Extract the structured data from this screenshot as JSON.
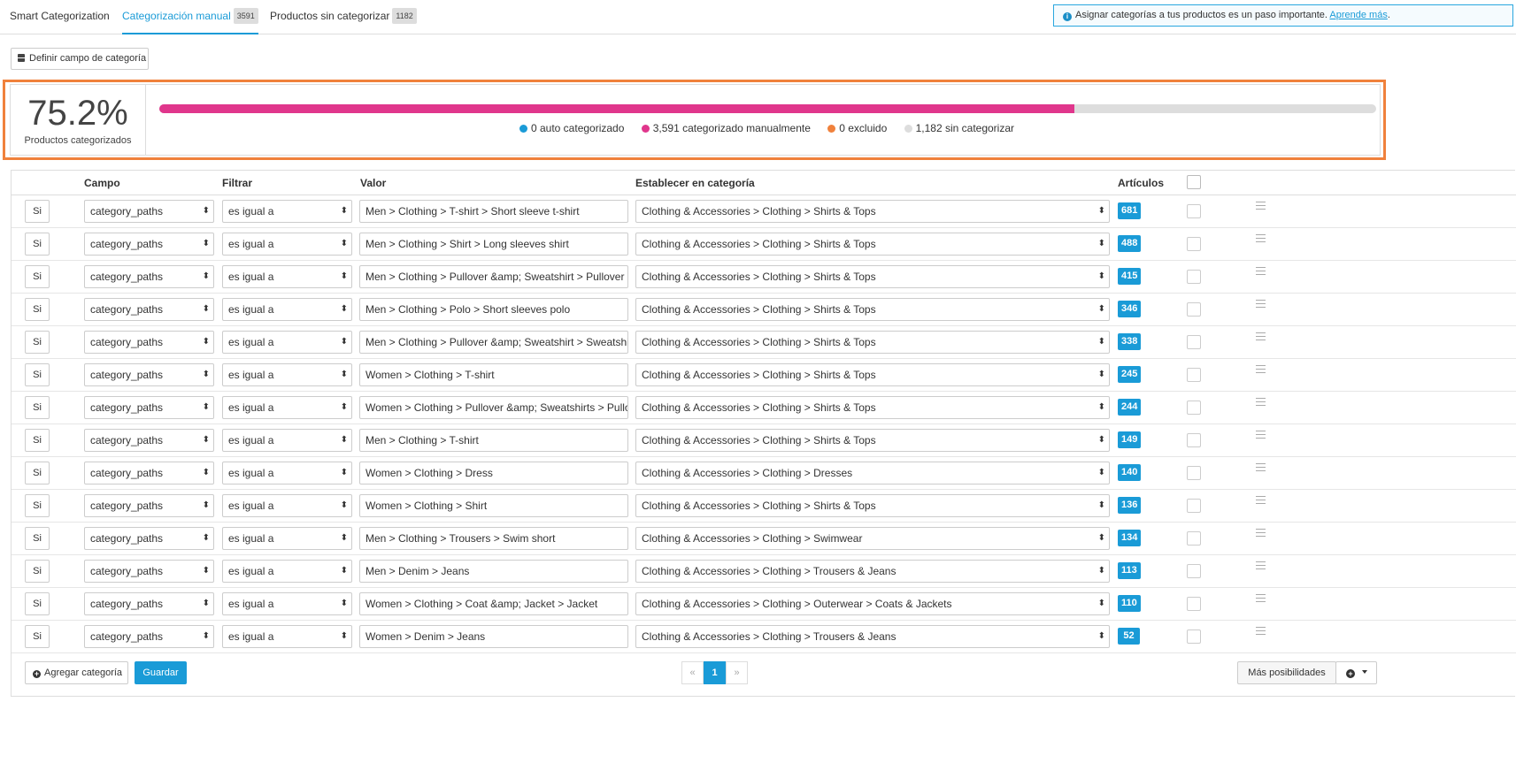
{
  "tabs": [
    {
      "label": "Smart Categorization",
      "badge": ""
    },
    {
      "label": "Categorización manual",
      "badge": "3591"
    },
    {
      "label": "Productos sin categorizar",
      "badge": "1182"
    }
  ],
  "info": {
    "text": "Asignar categorías a tus productos es un paso importante.",
    "link": "Aprende más",
    "link_suffix": "."
  },
  "define_button": "Definir campo de categoría",
  "stats": {
    "percent": "75.2%",
    "percent_label": "Productos categorizados",
    "progress_fraction": 0.752,
    "legend": [
      {
        "label": "0 auto categorizado",
        "color": "#1a9bd7"
      },
      {
        "label": "3,591 categorizado manualmente",
        "color": "#e0368c"
      },
      {
        "label": "0 excluido",
        "color": "#f0813c"
      },
      {
        "label": "1,182 sin categorizar",
        "color": "#dddddd"
      }
    ]
  },
  "table": {
    "headers": {
      "campo": "Campo",
      "filtrar": "Filtrar",
      "valor": "Valor",
      "categoria": "Establecer en categoría",
      "articulos": "Artículos"
    },
    "rows": [
      {
        "si": "Si",
        "campo": "category_paths",
        "filtro": "es igual a",
        "valor": "Men > Clothing > T-shirt > Short sleeve t-shirt",
        "categoria": "Clothing & Accessories > Clothing > Shirts & Tops",
        "count": "681"
      },
      {
        "si": "Si",
        "campo": "category_paths",
        "filtro": "es igual a",
        "valor": "Men > Clothing > Shirt > Long sleeves shirt",
        "categoria": "Clothing & Accessories > Clothing > Shirts & Tops",
        "count": "488"
      },
      {
        "si": "Si",
        "campo": "category_paths",
        "filtro": "es igual a",
        "valor": "Men > Clothing > Pullover &amp; Sweatshirt > Pullover",
        "categoria": "Clothing & Accessories > Clothing > Shirts & Tops",
        "count": "415"
      },
      {
        "si": "Si",
        "campo": "category_paths",
        "filtro": "es igual a",
        "valor": "Men > Clothing > Polo > Short sleeves polo",
        "categoria": "Clothing & Accessories > Clothing > Shirts & Tops",
        "count": "346"
      },
      {
        "si": "Si",
        "campo": "category_paths",
        "filtro": "es igual a",
        "valor": "Men > Clothing > Pullover &amp; Sweatshirt > Sweatshirt",
        "categoria": "Clothing & Accessories > Clothing > Shirts & Tops",
        "count": "338"
      },
      {
        "si": "Si",
        "campo": "category_paths",
        "filtro": "es igual a",
        "valor": "Women > Clothing > T-shirt",
        "categoria": "Clothing & Accessories > Clothing > Shirts & Tops",
        "count": "245"
      },
      {
        "si": "Si",
        "campo": "category_paths",
        "filtro": "es igual a",
        "valor": "Women > Clothing > Pullover &amp; Sweatshirts > Pullover",
        "categoria": "Clothing & Accessories > Clothing > Shirts & Tops",
        "count": "244"
      },
      {
        "si": "Si",
        "campo": "category_paths",
        "filtro": "es igual a",
        "valor": "Men > Clothing > T-shirt",
        "categoria": "Clothing & Accessories > Clothing > Shirts & Tops",
        "count": "149"
      },
      {
        "si": "Si",
        "campo": "category_paths",
        "filtro": "es igual a",
        "valor": "Women > Clothing > Dress",
        "categoria": "Clothing & Accessories > Clothing > Dresses",
        "count": "140"
      },
      {
        "si": "Si",
        "campo": "category_paths",
        "filtro": "es igual a",
        "valor": "Women > Clothing > Shirt",
        "categoria": "Clothing & Accessories > Clothing > Shirts & Tops",
        "count": "136"
      },
      {
        "si": "Si",
        "campo": "category_paths",
        "filtro": "es igual a",
        "valor": "Men > Clothing > Trousers > Swim short",
        "categoria": "Clothing & Accessories > Clothing > Swimwear",
        "count": "134"
      },
      {
        "si": "Si",
        "campo": "category_paths",
        "filtro": "es igual a",
        "valor": "Men > Denim > Jeans",
        "categoria": "Clothing & Accessories > Clothing > Trousers & Jeans",
        "count": "113"
      },
      {
        "si": "Si",
        "campo": "category_paths",
        "filtro": "es igual a",
        "valor": "Women > Clothing > Coat &amp; Jacket > Jacket",
        "categoria": "Clothing & Accessories > Clothing > Outerwear > Coats & Jackets",
        "count": "110"
      },
      {
        "si": "Si",
        "campo": "category_paths",
        "filtro": "es igual a",
        "valor": "Women > Denim > Jeans",
        "categoria": "Clothing & Accessories > Clothing > Trousers & Jeans",
        "count": "52"
      }
    ]
  },
  "footer": {
    "add_label": "Agregar categoría",
    "save_label": "Guardar",
    "pager": {
      "prev": "«",
      "page": "1",
      "next": "»"
    },
    "more_label": "Más posibilidades"
  },
  "icons": {
    "info": "info-icon",
    "define": "database-icon",
    "drag": "drag-handle-icon",
    "add": "plus-circle-icon",
    "gear": "plus-circle-icon"
  }
}
